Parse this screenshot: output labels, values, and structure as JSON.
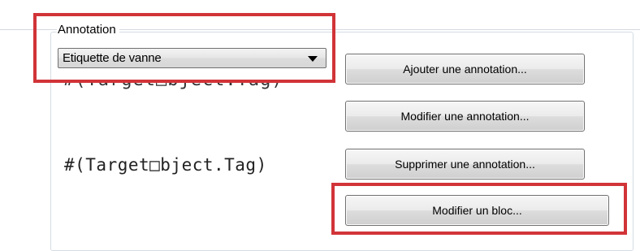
{
  "group": {
    "label": "Annotation"
  },
  "annotation_select": {
    "value": "Etiquette de vanne"
  },
  "preview": {
    "cut_text": "#(Target□bject.Tag)",
    "text": "#(Target□bject.Tag)"
  },
  "buttons": {
    "add": "Ajouter une annotation...",
    "edit": "Modifier une annotation...",
    "delete": "Supprimer une annotation...",
    "edit_block": "Modifier un bloc..."
  },
  "colors": {
    "highlight": "#d13438",
    "button_border": "#707070"
  }
}
